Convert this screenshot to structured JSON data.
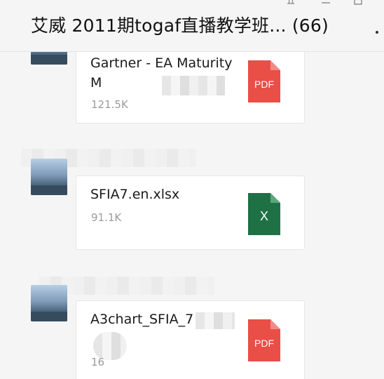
{
  "window": {
    "title": "艾威 2011期togaf直播教学班... (66)"
  },
  "messages": [
    {
      "file": {
        "name": "Gartner - EA Maturity M",
        "size": "121.5K",
        "type_label": "PDF",
        "icon": "pdf-file-icon",
        "color": "#e94e47"
      }
    },
    {
      "file": {
        "name": "SFIA7.en.xlsx",
        "size": "91.1K",
        "type_label": "X",
        "icon": "excel-file-icon",
        "color": "#1e7145"
      }
    },
    {
      "file": {
        "name": "A3chart_SFIA_7",
        "size": "16",
        "type_label": "PDF",
        "icon": "pdf-file-icon",
        "color": "#e94e47"
      }
    }
  ]
}
